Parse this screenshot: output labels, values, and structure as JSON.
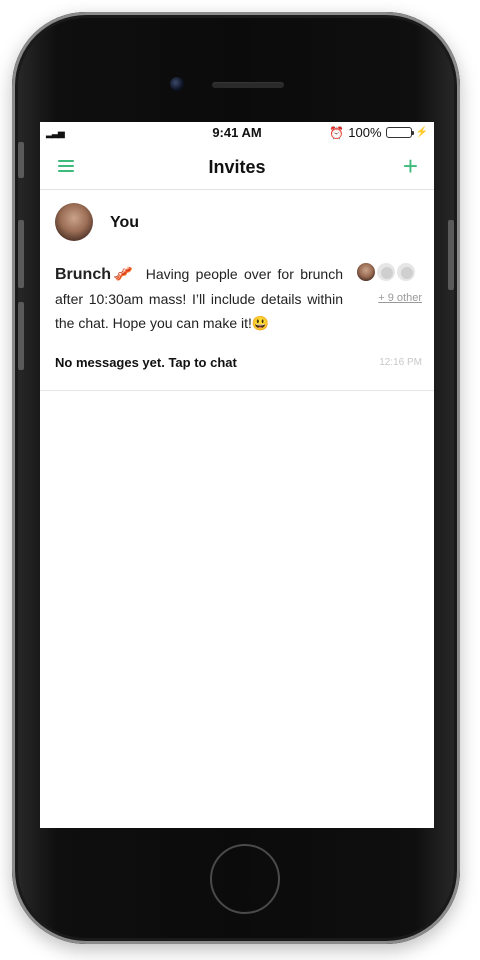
{
  "statusbar": {
    "signal": "▂▃▅",
    "time": "9:41 AM",
    "battery_text": "100%",
    "alarm_icon": "alarm-icon",
    "bolt_icon": "⚡"
  },
  "navbar": {
    "title": "Invites"
  },
  "invite": {
    "owner": "You",
    "title": "Brunch🥓",
    "description": "Having people over for brunch after 10:30am mass! I’ll include details within the chat. Hope you can make it!😃",
    "participants_more": "+ 9 other",
    "chat_prompt": "No messages yet. Tap to chat",
    "timestamp": "12:16 PM"
  },
  "colors": {
    "accent": "#3dbb7a",
    "battery": "#4cd964"
  }
}
